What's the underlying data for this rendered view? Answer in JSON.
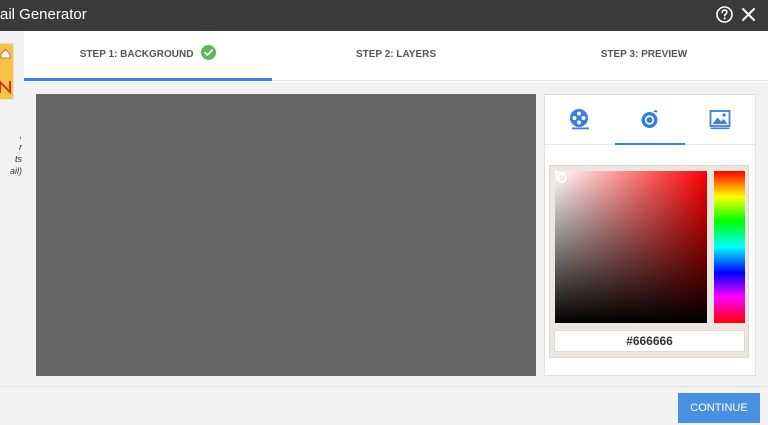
{
  "window": {
    "title": "ail Generator",
    "help_icon": "help-circle-icon",
    "close_icon": "close-icon"
  },
  "left_strip": {
    "text_lines": [
      ",",
      "r",
      "ts",
      "ail)"
    ]
  },
  "steps": [
    {
      "label": "STEP 1: BACKGROUND",
      "active": true,
      "completed": true
    },
    {
      "label": "STEP 2: LAYERS",
      "active": false,
      "completed": false
    },
    {
      "label": "STEP 3: PREVIEW",
      "active": false,
      "completed": false
    }
  ],
  "canvas": {
    "background_color": "#666666"
  },
  "panel": {
    "tabs": [
      {
        "icon": "film-reel-icon",
        "active": false
      },
      {
        "icon": "color-drop-icon",
        "active": true
      },
      {
        "icon": "image-icon",
        "active": false
      }
    ]
  },
  "color_picker": {
    "hex_value": "#666666",
    "hue_color": "#ff0000"
  },
  "colors": {
    "accent": "#3a7fd9",
    "button": "#4a90e2",
    "check_green": "#5cb85c",
    "titlebar": "#3a3a3a"
  },
  "footer": {
    "continue_label": "CONTINUE"
  }
}
